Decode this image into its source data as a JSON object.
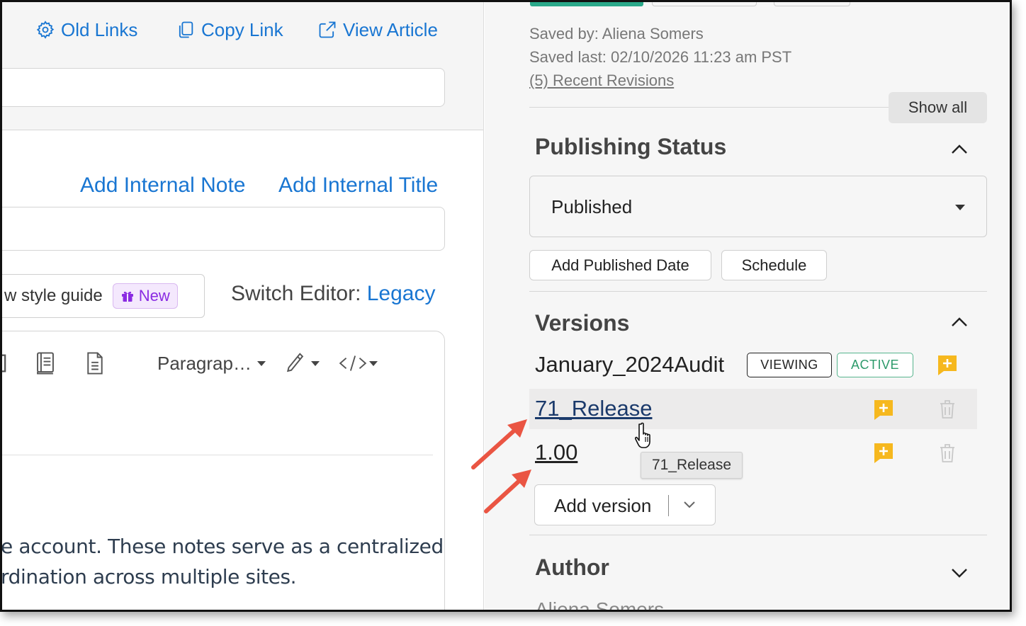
{
  "header_links": {
    "old_links": "Old Links",
    "copy_link": "Copy Link",
    "view_article": "View Article"
  },
  "internal": {
    "add_note": "Add Internal Note",
    "add_title": "Add Internal Title"
  },
  "style_guide": {
    "text": "w style guide",
    "badge": "New"
  },
  "switch_editor": {
    "label": "Switch Editor:",
    "link": "Legacy"
  },
  "toolbar": {
    "paragraph": "Paragrap…"
  },
  "body_text": {
    "line1": "e account. These notes serve as a centralized",
    "line2": "rdination across multiple sites."
  },
  "save_info": {
    "saved_by": "Saved by: Aliena Somers",
    "saved_last": "Saved last: 02/10/2026 11:23 am PST",
    "recent_revisions": "(5) Recent Revisions",
    "show_all": "Show all"
  },
  "publishing": {
    "title": "Publishing Status",
    "status_value": "Published",
    "add_date": "Add Published Date",
    "schedule": "Schedule"
  },
  "versions": {
    "title": "Versions",
    "items": [
      {
        "name": "January_2024Audit",
        "viewing": "VIEWING",
        "active": "ACTIVE"
      },
      {
        "name": "71_Release"
      },
      {
        "name": "1.00"
      }
    ],
    "tooltip": "71_Release",
    "add_version": "Add version"
  },
  "author": {
    "title": "Author",
    "value": "Aliena Somers"
  },
  "colors": {
    "link_blue": "#1976d2",
    "note_icon": "#f6b81e",
    "active_green": "#2d9a6b",
    "arrow_red": "#ea5543"
  }
}
